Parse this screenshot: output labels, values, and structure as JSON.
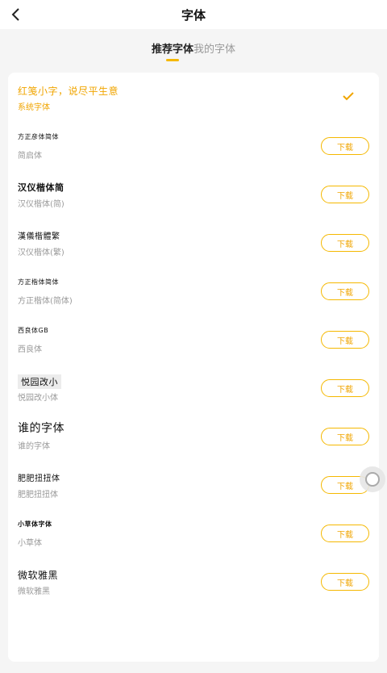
{
  "header": {
    "title": "字体"
  },
  "tabs": [
    {
      "label": "推荐字体",
      "active": true
    },
    {
      "label": "我的字体",
      "active": false
    }
  ],
  "accent_color": "#f5b800",
  "system_font": {
    "preview": "红笺小字，说尽平生意",
    "name": "系统字体",
    "selected": true
  },
  "fonts": [
    {
      "preview": "方正彦体简体",
      "name": "简启体",
      "button": "下载"
    },
    {
      "preview": "汉仪楷体简",
      "name": "汉仪楷体(简)",
      "button": "下载"
    },
    {
      "preview": "漢儀楷體繁",
      "name": "汉仪楷体(繁)",
      "button": "下载"
    },
    {
      "preview": "方正楷体简体",
      "name": "方正楷体(简体)",
      "button": "下载"
    },
    {
      "preview": "西良体GB",
      "name": "西良体",
      "button": "下载"
    },
    {
      "preview": "悦园改小",
      "name": "悦园改小体",
      "button": "下载"
    },
    {
      "preview": "谁的字体",
      "name": "谁的字体",
      "button": "下载"
    },
    {
      "preview": "肥肥扭扭体",
      "name": "肥肥扭扭体",
      "button": "下载"
    },
    {
      "preview": "小草体字体",
      "name": "小草体",
      "button": "下载"
    },
    {
      "preview": "微软雅黑",
      "name": "微软雅黑",
      "button": "下载"
    }
  ]
}
